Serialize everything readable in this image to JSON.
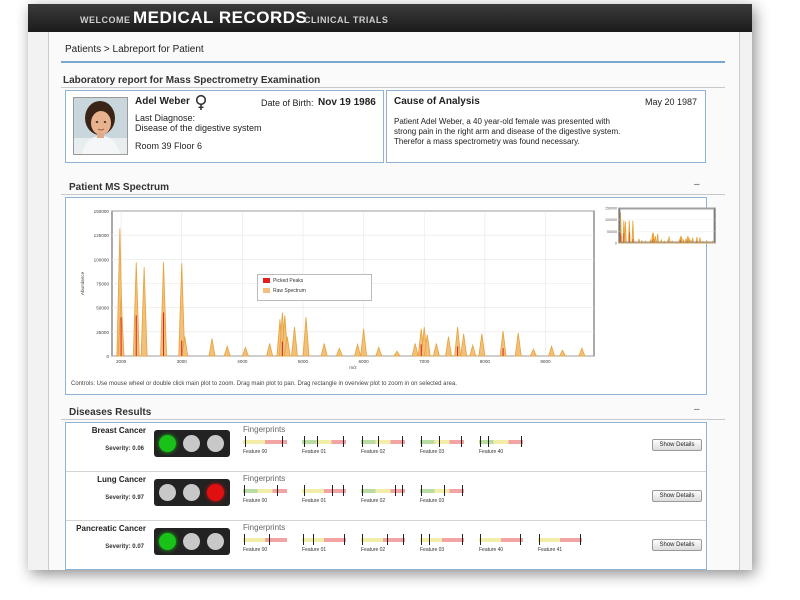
{
  "app": {
    "nav": {
      "welcome": "WELCOME",
      "title": "MEDICAL RECORDS",
      "trials": "CLINICAL TRIALS"
    },
    "breadcrumb": "Patients > Labreport for Patient"
  },
  "report": {
    "title": "Laboratory report for Mass Spectrometry Examination",
    "patient": {
      "name": "Adel Weber",
      "dob_label": "Date of Birth:",
      "dob": "Nov 19 1986",
      "last_diagnose_label": "Last Diagnose:",
      "last_diagnose": "Disease of the digestive system",
      "room": "Room 39 Floor 6",
      "gender_icon": "female-icon"
    },
    "cause": {
      "title": "Cause of Analysis",
      "date": "May 20 1987",
      "text": "Patient Adel Weber, a 40 year-old female was presented with strong pain in the right arm and disease of the digestive system. Therefor a mass spectrometry was found necessary."
    }
  },
  "spectrum": {
    "title": "Patient MS Spectrum",
    "collapse": "–",
    "controls": "Controls: Use mouse wheel or double click main plot to zoom. Drag main plot to pan. Drag rectangle in overview plot to zoom in on selected area.",
    "legend": [
      "Picked Peaks",
      "Raw Spectrum"
    ],
    "colors": {
      "picked": "#e02020",
      "raw": "#e8a23a",
      "rawfill": "#f2c07a"
    }
  },
  "chart_data": {
    "type": "line",
    "title": "",
    "xlabel": "m/z",
    "ylabel": "Abundance",
    "xlim": [
      1850,
      9800
    ],
    "ylim": [
      0,
      150000
    ],
    "x_ticks": [
      "2000",
      "3000",
      "4000",
      "5000",
      "6000",
      "7000",
      "8000",
      "9000"
    ],
    "y_ticks": [
      "0",
      "25000",
      "50000",
      "75000",
      "100000",
      "125000",
      "150000"
    ],
    "overview_y_ticks": [
      "0",
      "50000",
      "100000",
      "150000"
    ],
    "series": [
      {
        "name": "Raw Spectrum",
        "peaks": [
          {
            "x": 1980,
            "y": 132000
          },
          {
            "x": 2000,
            "y": 60000
          },
          {
            "x": 2250,
            "y": 97000
          },
          {
            "x": 2380,
            "y": 92000
          },
          {
            "x": 2700,
            "y": 97000
          },
          {
            "x": 3000,
            "y": 96000
          },
          {
            "x": 3050,
            "y": 20000
          },
          {
            "x": 3500,
            "y": 18000
          },
          {
            "x": 3750,
            "y": 10000
          },
          {
            "x": 4050,
            "y": 9000
          },
          {
            "x": 4450,
            "y": 13000
          },
          {
            "x": 4620,
            "y": 38000
          },
          {
            "x": 4660,
            "y": 45000
          },
          {
            "x": 4700,
            "y": 42000
          },
          {
            "x": 4740,
            "y": 20000
          },
          {
            "x": 4860,
            "y": 30000
          },
          {
            "x": 5050,
            "y": 40000
          },
          {
            "x": 5350,
            "y": 13000
          },
          {
            "x": 5600,
            "y": 8000
          },
          {
            "x": 5900,
            "y": 12000
          },
          {
            "x": 6000,
            "y": 28000
          },
          {
            "x": 6250,
            "y": 9000
          },
          {
            "x": 6550,
            "y": 5000
          },
          {
            "x": 6850,
            "y": 13000
          },
          {
            "x": 6950,
            "y": 28000
          },
          {
            "x": 7000,
            "y": 30000
          },
          {
            "x": 7050,
            "y": 22000
          },
          {
            "x": 7200,
            "y": 13000
          },
          {
            "x": 7400,
            "y": 20000
          },
          {
            "x": 7550,
            "y": 30000
          },
          {
            "x": 7650,
            "y": 23000
          },
          {
            "x": 7800,
            "y": 11000
          },
          {
            "x": 7950,
            "y": 23000
          },
          {
            "x": 8300,
            "y": 26000
          },
          {
            "x": 8550,
            "y": 24000
          },
          {
            "x": 8800,
            "y": 7000
          },
          {
            "x": 9100,
            "y": 10000
          },
          {
            "x": 9280,
            "y": 6000
          },
          {
            "x": 9600,
            "y": 8000
          }
        ]
      },
      {
        "name": "Picked Peaks",
        "peaks": [
          {
            "x": 2000,
            "y": 40000
          },
          {
            "x": 2250,
            "y": 42000
          },
          {
            "x": 2700,
            "y": 45000
          },
          {
            "x": 3000,
            "y": 16000
          },
          {
            "x": 4660,
            "y": 15000
          },
          {
            "x": 6950,
            "y": 12000
          },
          {
            "x": 7550,
            "y": 10000
          },
          {
            "x": 8300,
            "y": 8000
          }
        ]
      }
    ]
  },
  "diseases": {
    "title": "Diseases Results",
    "collapse": "–",
    "fingerprints_label": "Fingerprints",
    "details_label": "Show Details",
    "colors": {
      "green": "#18c218",
      "red": "#e01010",
      "off": "#c8c8c8",
      "bar_red": "#f2a3a3",
      "bar_green": "#b8dca4",
      "bar_yellow": "#f2eea8"
    },
    "rows": [
      {
        "name": "Breast Cancer",
        "severity": "Severity: 0.06",
        "lights": [
          "green",
          "off",
          "off"
        ],
        "features": [
          {
            "label": "Feature 00",
            "colors": [
              "yellow",
              "red"
            ],
            "marks": [
              0.05,
              0.9
            ]
          },
          {
            "label": "Feature 01",
            "colors": [
              "green",
              "yellow",
              "red"
            ],
            "marks": [
              0.05,
              0.35,
              0.95
            ]
          },
          {
            "label": "Feature 02",
            "colors": [
              "green",
              "yellow",
              "red"
            ],
            "marks": [
              0.02,
              0.4,
              0.95
            ]
          },
          {
            "label": "Feature 03",
            "colors": [
              "green",
              "yellow",
              "red"
            ],
            "marks": [
              0.02,
              0.45,
              0.95
            ]
          },
          {
            "label": "Feature 40",
            "colors": [
              "green",
              "yellow",
              "red"
            ],
            "marks": [
              0.02,
              0.2,
              0.98
            ]
          }
        ]
      },
      {
        "name": "Lung Cancer",
        "severity": "Severity: 0.97",
        "lights": [
          "off",
          "off",
          "red"
        ],
        "features": [
          {
            "label": "Feature 00",
            "colors": [
              "green",
              "yellow",
              "red"
            ],
            "marks": [
              0.02,
              0.78
            ]
          },
          {
            "label": "Feature 01",
            "colors": [
              "yellow",
              "red"
            ],
            "marks": [
              0.05,
              0.7,
              0.95
            ]
          },
          {
            "label": "Feature 02",
            "colors": [
              "green",
              "yellow",
              "red"
            ],
            "marks": [
              0.02,
              0.8,
              0.95
            ]
          },
          {
            "label": "Feature 03",
            "colors": [
              "green",
              "yellow",
              "red"
            ],
            "marks": [
              0.02,
              0.55,
              0.98
            ]
          }
        ]
      },
      {
        "name": "Pancreatic Cancer",
        "severity": "Severity: 0.07",
        "lights": [
          "green",
          "off",
          "off"
        ],
        "features": [
          {
            "label": "Feature 00",
            "colors": [
              "yellow",
              "red"
            ],
            "marks": [
              0.02,
              0.6
            ]
          },
          {
            "label": "Feature 01",
            "colors": [
              "yellow",
              "red"
            ],
            "marks": [
              0.02,
              0.25,
              0.98
            ]
          },
          {
            "label": "Feature 02",
            "colors": [
              "yellow",
              "red"
            ],
            "marks": [
              0.02,
              0.6,
              0.98
            ]
          },
          {
            "label": "Feature 03",
            "colors": [
              "yellow",
              "red"
            ],
            "marks": [
              0.02,
              0.2,
              0.98
            ]
          },
          {
            "label": "Feature 40",
            "colors": [
              "yellow",
              "red"
            ],
            "marks": [
              0.02,
              0.95
            ]
          },
          {
            "label": "Feature 41",
            "colors": [
              "yellow",
              "red"
            ],
            "marks": [
              0.02,
              0.98
            ]
          }
        ]
      }
    ]
  }
}
